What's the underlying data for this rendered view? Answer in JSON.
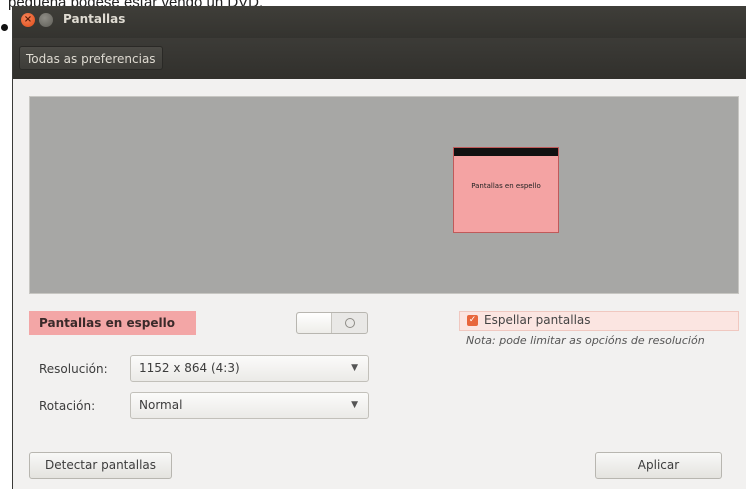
{
  "caption": "pequena podese estar vendo un DVD.",
  "window": {
    "title": "Pantallas",
    "toolbar_button": "Todas as preferencias"
  },
  "preview": {
    "monitor_label": "Pantallas en espello"
  },
  "display": {
    "name": "Pantallas en espello",
    "power": "off"
  },
  "settings": {
    "resolution_label": "Resolución:",
    "resolution_value": "1152 x 864 (4:3)",
    "rotation_label": "Rotación:",
    "rotation_value": "Normal"
  },
  "mirror": {
    "label": "Espellar pantallas",
    "checked": true,
    "note": "Nota: pode limitar as opcións de resolución"
  },
  "buttons": {
    "detect": "Detectar pantallas",
    "apply": "Aplicar"
  },
  "icons": {
    "close": "close-icon",
    "minimize": "minimize-icon",
    "dropdown": "chevron-down-icon",
    "check": "checkmark-icon"
  },
  "colors": {
    "accent": "#e8663c",
    "highlight": "#f3a6a6",
    "titlebar": "#3c3b37"
  }
}
